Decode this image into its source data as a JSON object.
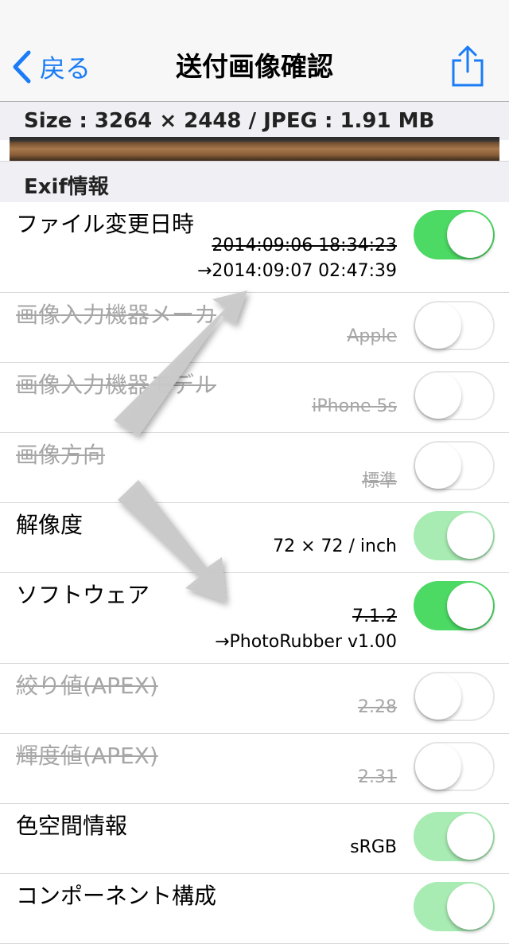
{
  "navbar": {
    "back_label": "戻る",
    "title": "送付画像確認",
    "share_icon": "share-icon"
  },
  "image_info": "Size : 3264 × 2448 / JPEG : 1.91 MB",
  "section_header": "Exif情報",
  "rows": [
    {
      "label": "ファイル変更日時",
      "value": "2014:09:06 18:34:23",
      "new_value": "→2014:09:07 02:47:39",
      "enabled": true
    },
    {
      "label": "画像入力機器メーカ",
      "value": "Apple",
      "enabled": false
    },
    {
      "label": "画像入力機器モデル",
      "value": "iPhone 5s",
      "enabled": false
    },
    {
      "label": "画像方向",
      "value": "標準",
      "enabled": false
    },
    {
      "label": "解像度",
      "value": "72 × 72 / inch",
      "enabled": true,
      "locked": true
    },
    {
      "label": "ソフトウェア",
      "value": "7.1.2",
      "new_value": "→PhotoRubber v1.00",
      "enabled": true
    },
    {
      "label": "絞り値(APEX)",
      "value": "2.28",
      "enabled": false
    },
    {
      "label": "輝度値(APEX)",
      "value": "2.31",
      "enabled": false
    },
    {
      "label": "色空間情報",
      "value": "sRGB",
      "enabled": true,
      "locked": true
    },
    {
      "label": "コンポーネント構成",
      "enabled": true,
      "locked": true
    }
  ],
  "colors": {
    "accent": "#1a7cf6",
    "switch_on": "#4cd964",
    "switch_locked": "#a8ebb3"
  }
}
